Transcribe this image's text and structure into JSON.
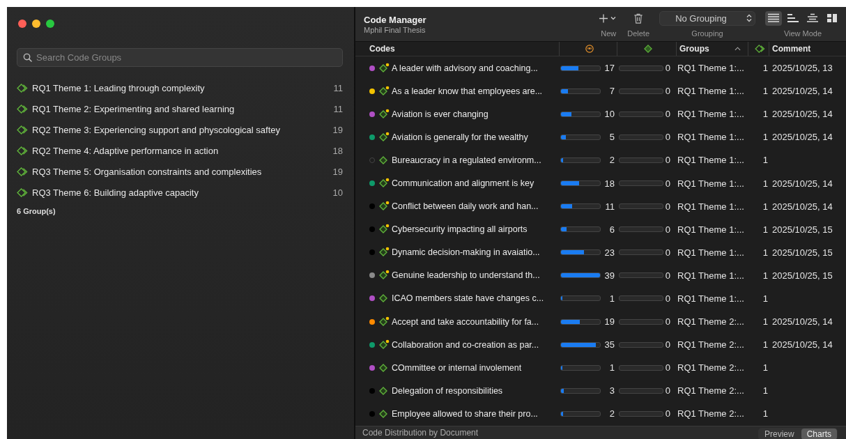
{
  "window": {
    "controls": [
      {
        "color": "#ff5f57"
      },
      {
        "color": "#febc2e"
      },
      {
        "color": "#28c840"
      }
    ]
  },
  "sidebar": {
    "search": {
      "placeholder": "Search Code Groups"
    },
    "groups": [
      {
        "name": "RQ1 Theme 1: Leading through complexity",
        "count": "11"
      },
      {
        "name": "RQ1 Theme 2: Experimenting and shared learning",
        "count": "11"
      },
      {
        "name": "RQ2 Theme 3: Experiencing support and physcological saftey",
        "count": "19"
      },
      {
        "name": "RQ2 Theme 4: Adaptive performance in action",
        "count": "18"
      },
      {
        "name": "RQ3 Theme 5: Organisation constraints and complexities",
        "count": "19"
      },
      {
        "name": "RQ3 Theme 6: Building adaptive capacity",
        "count": "10"
      }
    ],
    "footer": "6 Group(s)"
  },
  "toolbar": {
    "title": "Code Manager",
    "subtitle": "Mphil Final Thesis",
    "new_label": "New",
    "delete_label": "Delete",
    "grouping": {
      "value": "No Grouping",
      "label": "Grouping"
    },
    "view_modes": [
      {
        "kind": "list",
        "selected": true
      },
      {
        "kind": "bars",
        "selected": false
      },
      {
        "kind": "centered",
        "selected": false
      },
      {
        "kind": "grid",
        "selected": false
      }
    ],
    "view_mode_label": "View Mode"
  },
  "table": {
    "columns": [
      {
        "kind": "text",
        "label": "Codes",
        "sorted": false
      },
      {
        "kind": "quote-icon",
        "sorted": false
      },
      {
        "kind": "code-icon",
        "sorted": false
      },
      {
        "kind": "text",
        "label": "Groups",
        "sorted": true
      },
      {
        "kind": "groups-icon",
        "sorted": false
      },
      {
        "kind": "text",
        "label": "Comment",
        "sorted": false
      }
    ],
    "rows": [
      {
        "color": "#b04fc4",
        "memo": true,
        "name": "A leader with advisory and coaching...",
        "quotes": {
          "level": 0.44,
          "reading": "17"
        },
        "documents": {
          "level": 0,
          "reading": "0"
        },
        "group": "RQ1 Theme 1:...",
        "group_count": "1",
        "comment": "2025/10/25, 13"
      },
      {
        "color": "#f2c200",
        "memo": true,
        "name": "As a leader know that employees are...",
        "quotes": {
          "level": 0.18,
          "reading": "7"
        },
        "documents": {
          "level": 0,
          "reading": "0"
        },
        "group": "RQ1 Theme 1:...",
        "group_count": "1",
        "comment": "2025/10/25, 14"
      },
      {
        "color": "#b04fc4",
        "memo": true,
        "name": "Aviation is ever changing",
        "quotes": {
          "level": 0.26,
          "reading": "10"
        },
        "documents": {
          "level": 0,
          "reading": "0"
        },
        "group": "RQ1 Theme 1:...",
        "group_count": "1",
        "comment": "2025/10/25, 14"
      },
      {
        "color": "#0e9a6a",
        "memo": true,
        "name": "Aviation is generally for the wealthy",
        "quotes": {
          "level": 0.13,
          "reading": "5"
        },
        "documents": {
          "level": 0,
          "reading": "0"
        },
        "group": "RQ1 Theme 1:...",
        "group_count": "1",
        "comment": "2025/10/25, 14"
      },
      {
        "memo": false,
        "name": "Bureaucracy in a regulated environm...",
        "quotes": {
          "level": 0.05,
          "reading": "2"
        },
        "documents": {
          "level": 0,
          "reading": "0"
        },
        "group": "RQ1 Theme 1:...",
        "group_count": "1"
      },
      {
        "color": "#0e9a6a",
        "memo": true,
        "name": "Communication and alignment is key",
        "quotes": {
          "level": 0.46,
          "reading": "18"
        },
        "documents": {
          "level": 0,
          "reading": "0"
        },
        "group": "RQ1 Theme 1:...",
        "group_count": "1",
        "comment": "2025/10/25, 14"
      },
      {
        "color": "#000000",
        "memo": true,
        "name": "Conflict between daily work and han...",
        "quotes": {
          "level": 0.28,
          "reading": "11"
        },
        "documents": {
          "level": 0,
          "reading": "0"
        },
        "group": "RQ1 Theme 1:...",
        "group_count": "1",
        "comment": "2025/10/25, 14"
      },
      {
        "color": "#000000",
        "memo": true,
        "name": "Cybersecurity impacting all airports",
        "quotes": {
          "level": 0.15,
          "reading": "6"
        },
        "documents": {
          "level": 0,
          "reading": "0"
        },
        "group": "RQ1 Theme 1:...",
        "group_count": "1",
        "comment": "2025/10/25, 15"
      },
      {
        "color": "#000000",
        "memo": true,
        "name": "Dynamic decision-making in avaiatio...",
        "quotes": {
          "level": 0.59,
          "reading": "23"
        },
        "documents": {
          "level": 0,
          "reading": "0"
        },
        "group": "RQ1 Theme 1:...",
        "group_count": "1",
        "comment": "2025/10/25, 15"
      },
      {
        "color": "#8a8a8a",
        "memo": true,
        "name": "Genuine leadership to understand th...",
        "quotes": {
          "level": 1,
          "reading": "39"
        },
        "documents": {
          "level": 0,
          "reading": "0"
        },
        "group": "RQ1 Theme 1:...",
        "group_count": "1",
        "comment": "2025/10/25, 15"
      },
      {
        "color": "#b04fc4",
        "memo": false,
        "name": "ICAO members state have changes c...",
        "quotes": {
          "level": 0.03,
          "reading": "1"
        },
        "documents": {
          "level": 0,
          "reading": "0"
        },
        "group": "RQ1 Theme 1:...",
        "group_count": "1"
      },
      {
        "color": "#ff8a00",
        "memo": true,
        "name": "Accept and take accountability for fa...",
        "quotes": {
          "level": 0.49,
          "reading": "19"
        },
        "documents": {
          "level": 0,
          "reading": "0"
        },
        "group": "RQ1 Theme 2:...",
        "group_count": "1",
        "comment": "2025/10/25, 14"
      },
      {
        "color": "#0e9a6a",
        "memo": true,
        "name": "Collaboration and co-creation as par...",
        "quotes": {
          "level": 0.9,
          "reading": "35"
        },
        "documents": {
          "level": 0,
          "reading": "0"
        },
        "group": "RQ1 Theme 2:...",
        "group_count": "1",
        "comment": "2025/10/25, 14"
      },
      {
        "color": "#b04fc4",
        "memo": false,
        "name": "COmmittee or internal involement",
        "quotes": {
          "level": 0.03,
          "reading": "1"
        },
        "documents": {
          "level": 0,
          "reading": "0"
        },
        "group": "RQ1 Theme 2:...",
        "group_count": "1"
      },
      {
        "color": "#000000",
        "memo": false,
        "name": "Delegation of responsibilities",
        "quotes": {
          "level": 0.08,
          "reading": "3"
        },
        "documents": {
          "level": 0,
          "reading": "0"
        },
        "group": "RQ1 Theme 2:...",
        "group_count": "1"
      },
      {
        "color": "#000000",
        "memo": false,
        "name": "Employee allowed to share their pro...",
        "quotes": {
          "level": 0.05,
          "reading": "2"
        },
        "documents": {
          "level": 0,
          "reading": "0"
        },
        "group": "RQ1 Theme 2:...",
        "group_count": "1"
      }
    ]
  },
  "bottom_bar": {
    "title": "Code Distribution by Document",
    "tabs": [
      {
        "label": "Preview",
        "selected": false
      },
      {
        "label": "Charts",
        "selected": true
      }
    ]
  }
}
